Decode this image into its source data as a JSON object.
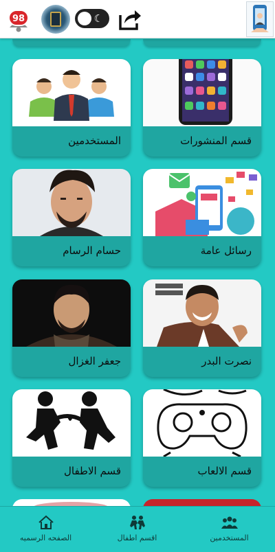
{
  "header": {
    "notification_count": "98",
    "icons": [
      "bell-icon",
      "quran-icon",
      "dark-mode-toggle",
      "share-icon",
      "app-logo-icon"
    ]
  },
  "cards": [
    {
      "label": "قسم المنشورات",
      "icon": "smartphone-image"
    },
    {
      "label": "المستخدمين",
      "icon": "users-group-image"
    },
    {
      "label": "رسائل عامة",
      "icon": "messages-image"
    },
    {
      "label": "حسام الرسام",
      "icon": "person-photo"
    },
    {
      "label": "نصرت البدر",
      "icon": "person-photo"
    },
    {
      "label": "جعفر الغزال",
      "icon": "person-photo"
    },
    {
      "label": "قسم الالعاب",
      "icon": "gamepad-image"
    },
    {
      "label": "قسم الاطفال",
      "icon": "children-image"
    }
  ],
  "nav": {
    "items": [
      {
        "label": "المستخدمين",
        "icon": "users-icon"
      },
      {
        "label": "اقسم اطفال",
        "icon": "kids-icon"
      },
      {
        "label": "الصفحه الرسميه",
        "icon": "home-icon"
      }
    ]
  },
  "colors": {
    "accent": "#23c9c4",
    "card_footer": "#1fa6a1",
    "badge": "#d9262b"
  }
}
